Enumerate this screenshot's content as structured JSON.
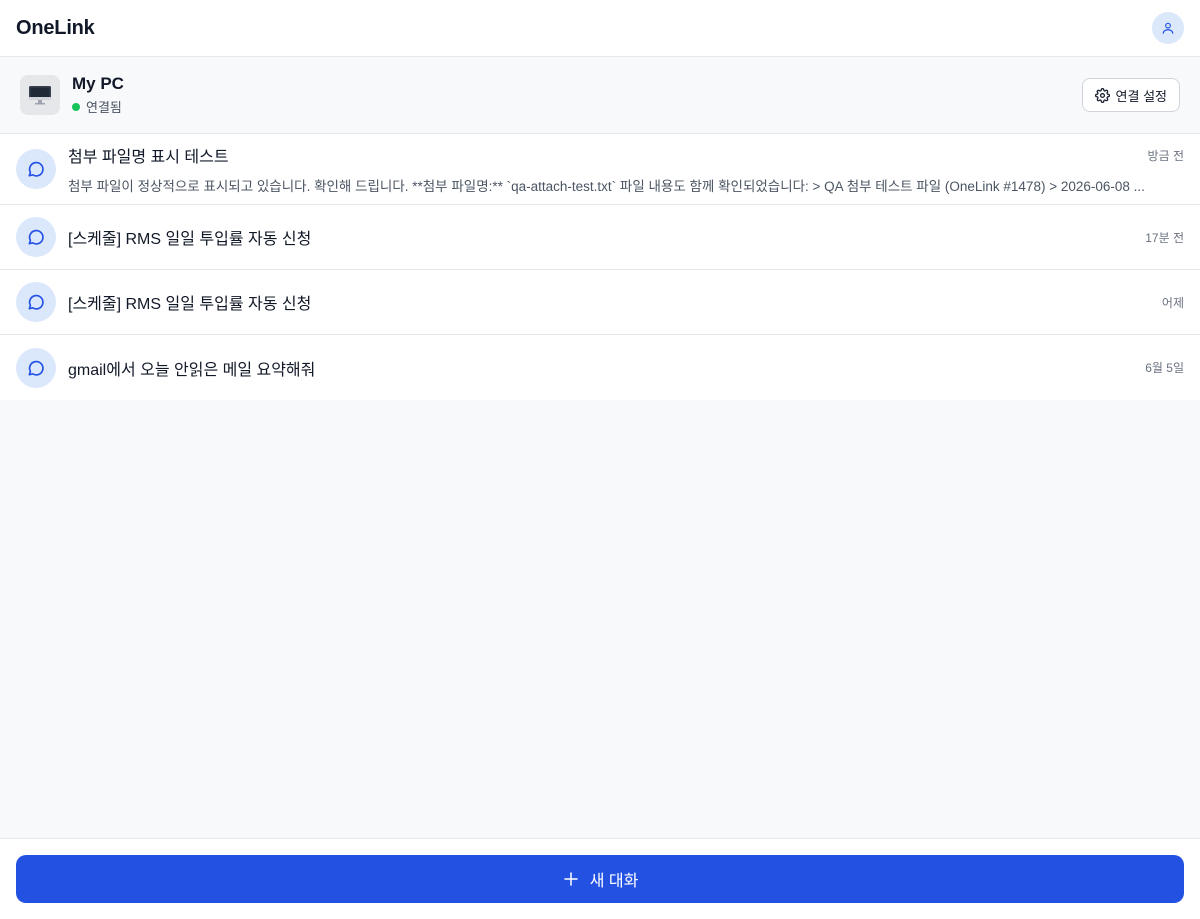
{
  "app": {
    "title": "OneLink",
    "profile_icon": "user-icon"
  },
  "device": {
    "name": "My PC",
    "status": "연결됨",
    "status_color": "#16c45a",
    "thumb_icon": "monitor-icon",
    "settings_label": "연결 설정",
    "settings_icon": "gear-icon"
  },
  "conversations": [
    {
      "title": "첨부 파일명 표시 테스트",
      "time": "방금 전",
      "preview": "첨부 파일이 정상적으로 표시되고 있습니다. 확인해 드립니다. **첨부 파일명:** `qa-attach-test.txt` 파일 내용도 함께 확인되었습니다: > QA 첨부 테스트 파일 (OneLink #1478) > 2026-06-08 ...",
      "icon": "chat-bubble-icon"
    },
    {
      "title": "[스케줄] RMS 일일 투입률 자동 신청",
      "time": "17분 전",
      "icon": "chat-bubble-icon"
    },
    {
      "title": "[스케줄] RMS 일일 투입률 자동 신청",
      "time": "어제",
      "icon": "chat-bubble-icon"
    },
    {
      "title": "gmail에서 오늘 안읽은 메일 요약해줘",
      "time": "6월 5일",
      "icon": "chat-bubble-icon"
    }
  ],
  "footer": {
    "new_chat_label": "새 대화",
    "new_chat_icon": "plus-icon",
    "accent": "#2352e3"
  }
}
